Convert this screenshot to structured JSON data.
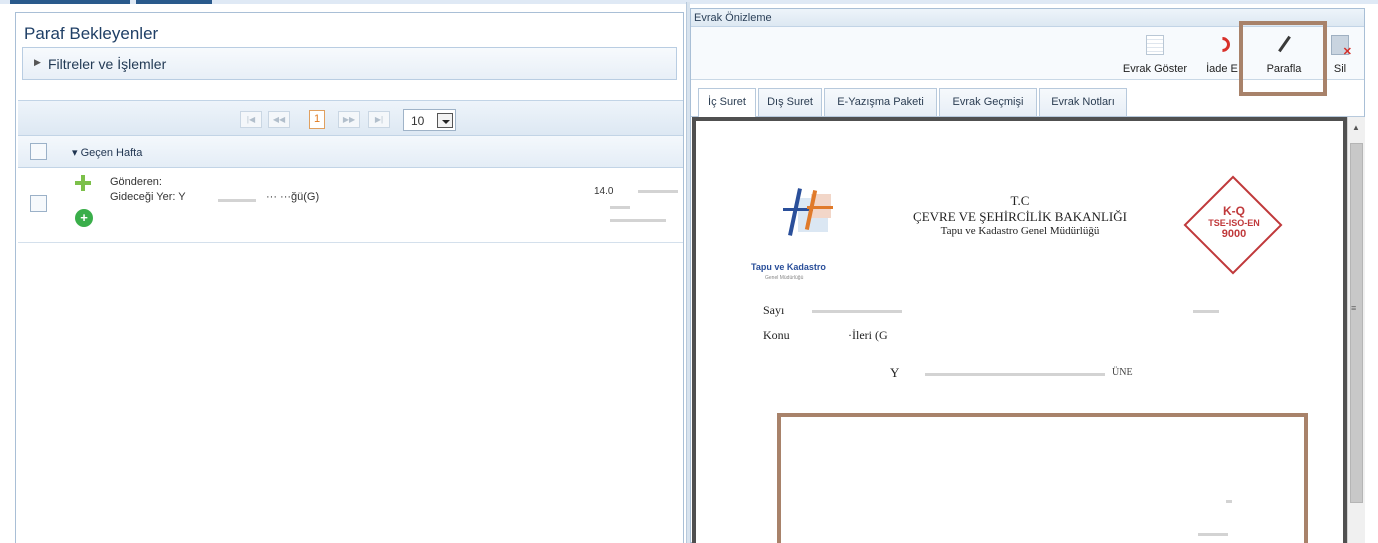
{
  "left": {
    "title": "Paraf Bekleyenler",
    "filter_label": "Filtreler ve İşlemler",
    "pager": {
      "current": "1",
      "page_size": "10"
    },
    "group_label": "▾ Geçen Hafta",
    "row": {
      "line1": "Gönderen:",
      "line2": "Gideceği Yer: Y",
      "line2_tail": "··· ···ğü(G)",
      "date": "14.0"
    }
  },
  "right": {
    "header": "Evrak Önizleme",
    "toolbar": {
      "evrak_goster": "Evrak Göster",
      "iade_et": "İade E",
      "parafla": "Parafla",
      "sil": "Sil"
    },
    "tabs": [
      "İç Suret",
      "Dış Suret",
      "E-Yazışma Paketi",
      "Evrak Geçmişi",
      "Evrak Notları"
    ],
    "document": {
      "tc": "T.C",
      "ministry": "ÇEVRE VE ŞEHİRCİLİK BAKANLIĞI",
      "directorate": "Tapu ve Kadastro Genel Müdürlüğü",
      "logo_text": "Tapu ve Kadastro",
      "logo_sub": "Genel Müdürlüğü",
      "kq_line1": "K-Q",
      "kq_line2": "TSE-ISO-EN",
      "kq_line3": "9000",
      "sayi_label": "Sayı",
      "konu_label": "Konu",
      "konu_value": "·İleri (G",
      "addressee": "Y",
      "addressee_tail": "ÜNE"
    }
  }
}
